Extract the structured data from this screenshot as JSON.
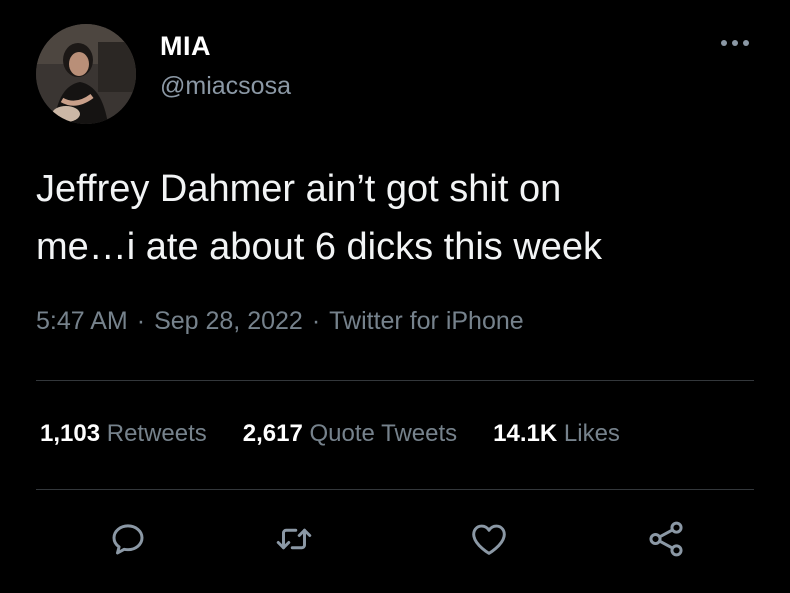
{
  "user": {
    "display_name": "MIA",
    "handle": "@miacsosa",
    "avatar": "profile-photo"
  },
  "tweet": {
    "text_line1": "Jeffrey Dahmer ain’t got shit on",
    "text_line2": "me…i ate about 6 dicks this week",
    "time": "5:47 AM",
    "date": "Sep 28, 2022",
    "source": "Twitter for iPhone",
    "separator": "·"
  },
  "stats": {
    "retweets_count": "1,103",
    "retweets_label": "Retweets",
    "quotes_count": "2,617",
    "quotes_label": "Quote Tweets",
    "likes_count": "14.1K",
    "likes_label": "Likes"
  },
  "actions": {
    "icons": [
      "reply-icon",
      "retweet-icon",
      "like-icon",
      "share-icon"
    ]
  },
  "colors": {
    "background": "#000000",
    "primary_text": "#ffffff",
    "secondary_text": "#76828c",
    "divider": "#33373b"
  }
}
